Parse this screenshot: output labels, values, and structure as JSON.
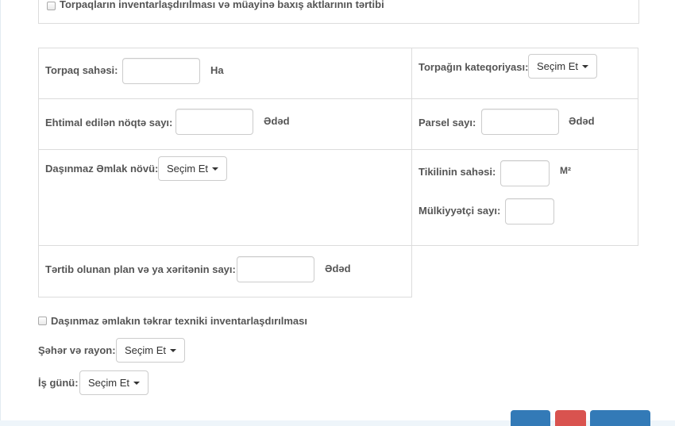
{
  "top_section": {
    "checkbox_label": "Torpaqların inventarlaşdırılması və müayinə baxış aktlarının tərtibi"
  },
  "form": {
    "land_area_label": "Torpaq sahəsi:",
    "land_area_unit": "Ha",
    "land_category_label": "Torpağın kateqoriyası:",
    "land_category_dropdown": "Seçim Et",
    "estimated_points_label": "Ehtimal edilən nöqtə sayı:",
    "estimated_points_unit": "Ədəd",
    "parcel_count_label": "Parsel sayı:",
    "parcel_count_unit": "Ədəd",
    "property_type_label": "Daşınmaz Əmlak növü:",
    "property_type_dropdown": "Seçim Et",
    "building_area_label": "Tikilinin sahəsi:",
    "building_area_unit": "M²",
    "owner_count_label": "Mülkiyyətçi sayı:",
    "plan_count_label": "Tərtib olunan plan və ya xəritənin sayı:",
    "plan_count_unit": "Ədəd"
  },
  "bottom_section": {
    "reinventory_checkbox_label": "Daşınmaz əmlakın təkrar texniki inventarlaşdırılması",
    "city_district_label": "Şəhər və rayon:",
    "city_district_dropdown": "Seçim Et",
    "work_day_label": "İş günü:",
    "work_day_dropdown": "Seçim Et"
  },
  "colors": {
    "primary_button": "#337ab7",
    "danger_button": "#d9534f"
  }
}
